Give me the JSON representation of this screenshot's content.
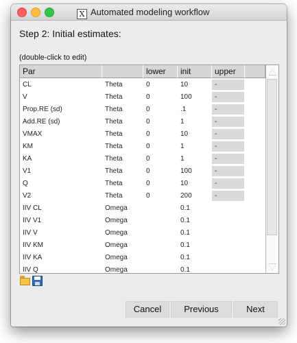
{
  "window": {
    "title": "Automated modeling workflow",
    "title_icon": "X"
  },
  "step_title": "Step 2: Initial estimates:",
  "hint": "(double-click to edit)",
  "table": {
    "columns": [
      "Par",
      "",
      "lower",
      "init",
      "upper"
    ],
    "rows": [
      {
        "par": "CL",
        "type": "Theta",
        "lower": "0",
        "init": "10",
        "upper": "-"
      },
      {
        "par": "V",
        "type": "Theta",
        "lower": "0",
        "init": "100",
        "upper": "-"
      },
      {
        "par": "Prop.RE (sd)",
        "type": "Theta",
        "lower": "0",
        "init": ".1",
        "upper": "-"
      },
      {
        "par": "Add.RE (sd)",
        "type": "Theta",
        "lower": "0",
        "init": "1",
        "upper": "-"
      },
      {
        "par": "VMAX",
        "type": "Theta",
        "lower": "0",
        "init": "10",
        "upper": "-"
      },
      {
        "par": "KM",
        "type": "Theta",
        "lower": "0",
        "init": "1",
        "upper": "-"
      },
      {
        "par": "KA",
        "type": "Theta",
        "lower": "0",
        "init": "1",
        "upper": "-"
      },
      {
        "par": "V1",
        "type": "Theta",
        "lower": "0",
        "init": "100",
        "upper": "-"
      },
      {
        "par": "Q",
        "type": "Theta",
        "lower": "0",
        "init": "10",
        "upper": "-"
      },
      {
        "par": "V2",
        "type": "Theta",
        "lower": "0",
        "init": "200",
        "upper": "-"
      },
      {
        "par": "IIV CL",
        "type": "Omega",
        "lower": "",
        "init": "0.1",
        "upper": ""
      },
      {
        "par": "IIV V1",
        "type": "Omega",
        "lower": "",
        "init": "0.1",
        "upper": ""
      },
      {
        "par": "IIV V",
        "type": "Omega",
        "lower": "",
        "init": "0.1",
        "upper": ""
      },
      {
        "par": "IIV KM",
        "type": "Omega",
        "lower": "",
        "init": "0.1",
        "upper": ""
      },
      {
        "par": "IIV KA",
        "type": "Omega",
        "lower": "",
        "init": "0.1",
        "upper": ""
      },
      {
        "par": "IIV Q",
        "type": "Omega",
        "lower": "",
        "init": "0.1",
        "upper": ""
      }
    ]
  },
  "buttons": {
    "cancel": "Cancel",
    "previous": "Previous",
    "next": "Next"
  },
  "icons": [
    "folder-open-icon",
    "save-floppy-icon"
  ]
}
